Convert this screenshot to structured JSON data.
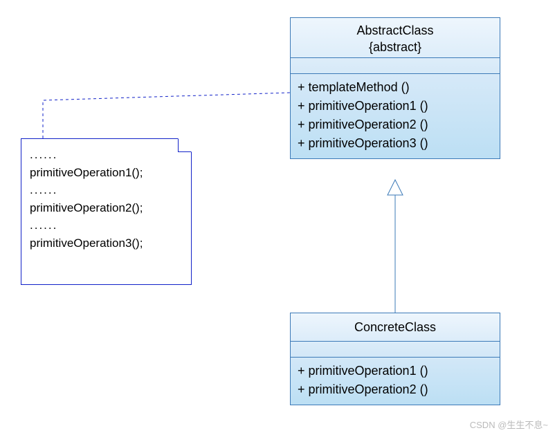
{
  "diagram": {
    "abstractClass": {
      "name": "AbstractClass",
      "stereotype": "{abstract}",
      "operations": [
        "+  templateMethod ()",
        "+  primitiveOperation1 ()",
        "+  primitiveOperation2 ()",
        "+  primitiveOperation3 ()"
      ]
    },
    "concreteClass": {
      "name": "ConcreteClass",
      "operations": [
        "+  primitiveOperation1 ()",
        "+  primitiveOperation2 ()"
      ]
    },
    "note": {
      "lines": [
        "......",
        "primitiveOperation1();",
        "......",
        "primitiveOperation2();",
        "......",
        "primitiveOperation3();"
      ]
    },
    "relations": {
      "generalization": {
        "from": "ConcreteClass",
        "to": "AbstractClass"
      },
      "noteAnchor": {
        "from": "note",
        "to": "AbstractClass.templateMethod"
      }
    }
  },
  "watermark": "CSDN @生生不息~"
}
